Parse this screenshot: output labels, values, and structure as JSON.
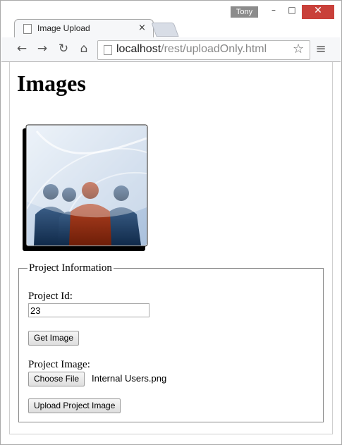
{
  "browser": {
    "user_badge": "Tony",
    "tab_title": "Image Upload",
    "tab_close": "×",
    "url_host": "localhost",
    "url_path": "/rest/uploadOnly.html",
    "window_controls": {
      "minimize": "–",
      "maximize": "□",
      "close": "✕"
    },
    "nav": {
      "back": "←",
      "forward": "→",
      "reload": "↻",
      "home": "⌂",
      "star": "☆",
      "menu": "≡"
    }
  },
  "page": {
    "title": "Images",
    "fieldset": {
      "legend": "Project Information",
      "project_id_label": "Project Id:",
      "project_id_value": "23",
      "get_image_button": "Get Image",
      "project_image_label": "Project Image:",
      "choose_file_button": "Choose File",
      "chosen_file_name": "Internal Users.png",
      "upload_button": "Upload Project Image"
    }
  },
  "colors": {
    "close_button": "#c9403a",
    "image_shadow": "#000000",
    "image_bg_light": "#dfe8f3",
    "image_bg_dark": "#b3c7de",
    "person_blue": "#1d3b5e",
    "person_red": "#8a2a10"
  }
}
